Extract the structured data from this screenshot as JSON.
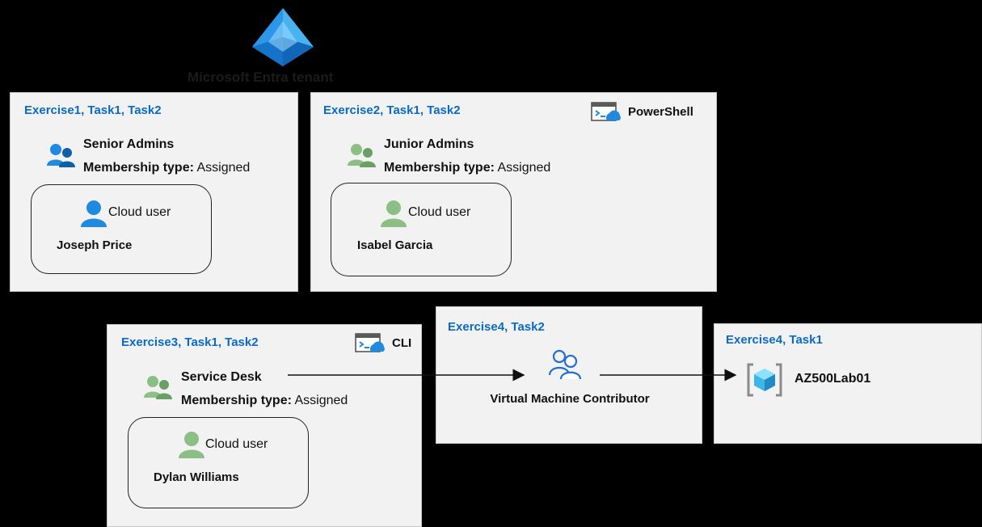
{
  "tenant": {
    "label": "Microsoft Entra tenant",
    "icon": "entra-id-icon"
  },
  "panels": {
    "ex1": {
      "title": "Exercise1, Task1, Task2",
      "group": {
        "name": "Senior Admins",
        "membership_label": "Membership type:",
        "membership_value": "Assigned",
        "icon": "group-icon"
      },
      "user": {
        "label": "Cloud user",
        "name": "Joseph Price",
        "icon": "user-icon"
      }
    },
    "ex2": {
      "title": "Exercise2, Task1, Task2",
      "tool": "PowerShell",
      "group": {
        "name": "Junior Admins",
        "membership_label": "Membership type:",
        "membership_value": "Assigned",
        "icon": "group-icon"
      },
      "user": {
        "label": "Cloud user",
        "name": "Isabel Garcia",
        "icon": "user-icon"
      }
    },
    "ex3": {
      "title": "Exercise3, Task1, Task2",
      "tool": "CLI",
      "group": {
        "name": "Service Desk",
        "membership_label": "Membership type:",
        "membership_value": "Assigned",
        "icon": "group-icon"
      },
      "user": {
        "label": "Cloud user",
        "name": "Dylan Williams",
        "icon": "user-icon"
      }
    },
    "ex4_task2": {
      "title": "Exercise4, Task2",
      "role": "Virtual Machine Contributor",
      "icon": "role-icon"
    },
    "ex4_task1": {
      "title": "Exercise4, Task1",
      "resource": "AZ500Lab01",
      "icon": "resource-group-icon"
    }
  },
  "colors": {
    "background": "#000000",
    "panel": "#f2f2f2",
    "title_blue": "#0a6ac4",
    "user_blue": "#1f8ae0",
    "user_green": "#7bb07b"
  }
}
